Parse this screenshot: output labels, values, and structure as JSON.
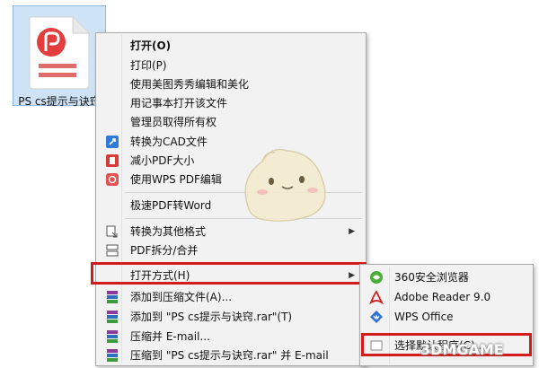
{
  "desktop": {
    "file_label": "PS cs提示与诀窍"
  },
  "context_menu": {
    "items": [
      {
        "label": "打开(O)",
        "bold": true
      },
      {
        "label": "打印(P)"
      },
      {
        "label": "使用美图秀秀编辑和美化"
      },
      {
        "label": "用记事本打开该文件"
      },
      {
        "label": "管理员取得所有权"
      },
      {
        "label": "转换为CAD文件",
        "icon": "cad-convert-icon"
      },
      {
        "label": "减小PDF大小",
        "icon": "pdf-compress-icon"
      },
      {
        "label": "使用WPS PDF编辑",
        "icon": "wps-pdf-icon"
      },
      {
        "label": "极速PDF转Word"
      },
      {
        "label": "转换为其他格式",
        "icon": "convert-format-icon",
        "submenu": true
      },
      {
        "label": "PDF拆分/合并",
        "icon": "pdf-split-icon"
      },
      {
        "label": "打开方式(H)",
        "submenu": true
      },
      {
        "label": "添加到压缩文件(A)...",
        "icon": "winrar-icon"
      },
      {
        "label": "添加到 \"PS cs提示与诀窍.rar\"(T)",
        "icon": "winrar-icon"
      },
      {
        "label": "压缩并 E-mail...",
        "icon": "winrar-icon"
      },
      {
        "label": "压缩到 \"PS cs提示与诀窍.rar\" 并 E-mail",
        "icon": "winrar-icon"
      }
    ]
  },
  "open_with_submenu": {
    "items": [
      {
        "label": "360安全浏览器",
        "icon": "360-browser-icon"
      },
      {
        "label": "Adobe Reader 9.0",
        "icon": "adobe-reader-icon"
      },
      {
        "label": "WPS Office",
        "icon": "wps-office-icon"
      },
      {
        "label": "选择默认程序(C)...",
        "icon": "default-program-icon"
      }
    ]
  },
  "watermark": "3DMGAME",
  "colors": {
    "highlight_border": "#d41b1b",
    "menu_bg": "#f2f2f2",
    "file_tile_bg": "#cfe3f7"
  }
}
